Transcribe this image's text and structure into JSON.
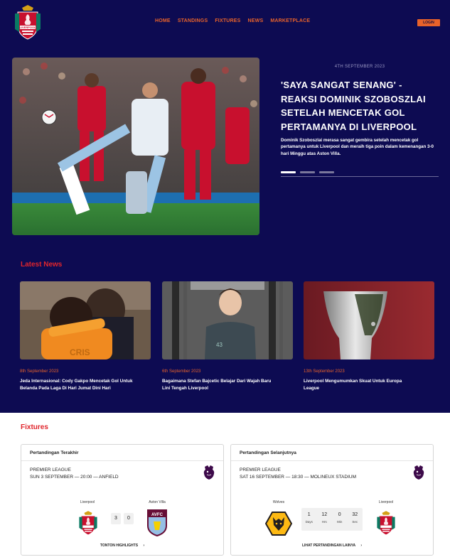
{
  "header": {
    "nav": [
      "HOME",
      "STANDINGS",
      "FIXTURES",
      "NEWS",
      "MARKETPLACE"
    ],
    "login_label": "LOGIN",
    "crest_text": "LIVERPOOL"
  },
  "hero": {
    "date": "4TH SEPTEMBER 2023",
    "title": "'SAYA SANGAT SENANG' - REAKSI DOMINIK SZOBOSZLAI SETELAH MENCETAK GOL PERTAMANYA DI LIVERPOOL",
    "description": "Dominik Szoboszlai merasa sangat gembira setelah mencetak gol pertamanya untuk Liverpool dan meraih tiga poin dalam kemenangan 3-0 hari Minggu atas Aston Villa.",
    "slide_count": 3,
    "active_slide": 1
  },
  "latest_news": {
    "title": "Latest News",
    "items": [
      {
        "date": "8th September 2023",
        "headline": "Jeda Internasional: Cody Gakpo Mencetak Gol Untuk Belanda Pada Laga Di Hari Jumat Dini Hari"
      },
      {
        "date": "6th September 2023",
        "headline": "Bagaimana Stefan Bajcetic Belajar Dari Wajah Baru Lini Tengah Liverpool"
      },
      {
        "date": "13th September 2023",
        "headline": "Liverpool Mengumumkan Skuat Untuk Europa League"
      }
    ]
  },
  "fixtures": {
    "title": "Fixtures",
    "last": {
      "heading": "Pertandingan Terakhir",
      "competition": "PREMIER LEAGUE",
      "info": "SUN 3 SEPTEMBER — 20:00 — ANFIELD",
      "home": "Liverpool",
      "away": "Aston Villa",
      "home_score": "3",
      "away_score": "0",
      "away_crest_text": "AVFC",
      "link": "TONTON HIGHLIGHTS"
    },
    "next": {
      "heading": "Pertandingan Selanjutnya",
      "competition": "PREMIER LEAGUE",
      "info": "SAT 16 SEPTEMBER — 18:30 — MOLINEUX STADIUM",
      "home": "Wolves",
      "away": "Liverpool",
      "countdown": [
        {
          "value": "1",
          "label": "Days"
        },
        {
          "value": "12",
          "label": "Hrs"
        },
        {
          "value": "0",
          "label": "Min"
        },
        {
          "value": "32",
          "label": "Sec"
        }
      ],
      "link": "LIHAT PERTANDINGAN LAINYA"
    }
  },
  "icons": {
    "crest": "liverpool-crest-icon",
    "premier_league": "premier-league-lion-icon",
    "wolves": "wolves-crest-icon",
    "villa": "aston-villa-crest-icon",
    "chevron": "chevron-right-icon"
  },
  "colors": {
    "navy": "#0d0b52",
    "accent_orange": "#e8622a",
    "section_red": "#e0252c",
    "liverpool_red": "#c8102e",
    "liverpool_green": "#0b7a63"
  }
}
